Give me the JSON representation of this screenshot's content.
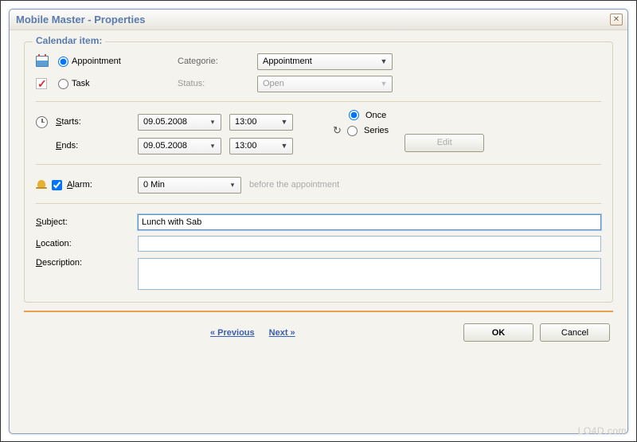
{
  "window": {
    "title": "Mobile Master - Properties"
  },
  "fieldset": {
    "legend": "Calendar item:"
  },
  "type_section": {
    "appointment_label": "Appointment",
    "appointment_selected": true,
    "task_label": "Task",
    "task_selected": false,
    "categorie_label": "Categorie:",
    "status_label": "Status:",
    "categorie_value": "Appointment",
    "status_value": "Open"
  },
  "time_section": {
    "starts_label": "Starts:",
    "ends_label": "Ends:",
    "start_date": "09.05.2008",
    "start_time": "13:00",
    "end_date": "09.05.2008",
    "end_time": "13:00",
    "once_label": "Once",
    "once_selected": true,
    "series_label": "Series",
    "series_selected": false,
    "edit_label": "Edit"
  },
  "alarm_section": {
    "alarm_label": "Alarm:",
    "alarm_checked": true,
    "alarm_value": "0 Min",
    "before_text": "before the appointment"
  },
  "text_section": {
    "subject_label": "Subject:",
    "subject_value": "Lunch with Sab",
    "location_label": "Location:",
    "location_value": "",
    "description_label": "Description:",
    "description_value": ""
  },
  "nav": {
    "previous": "« Previous",
    "next": "Next »"
  },
  "buttons": {
    "ok": "OK",
    "cancel": "Cancel"
  },
  "watermark": "LO4D.com"
}
